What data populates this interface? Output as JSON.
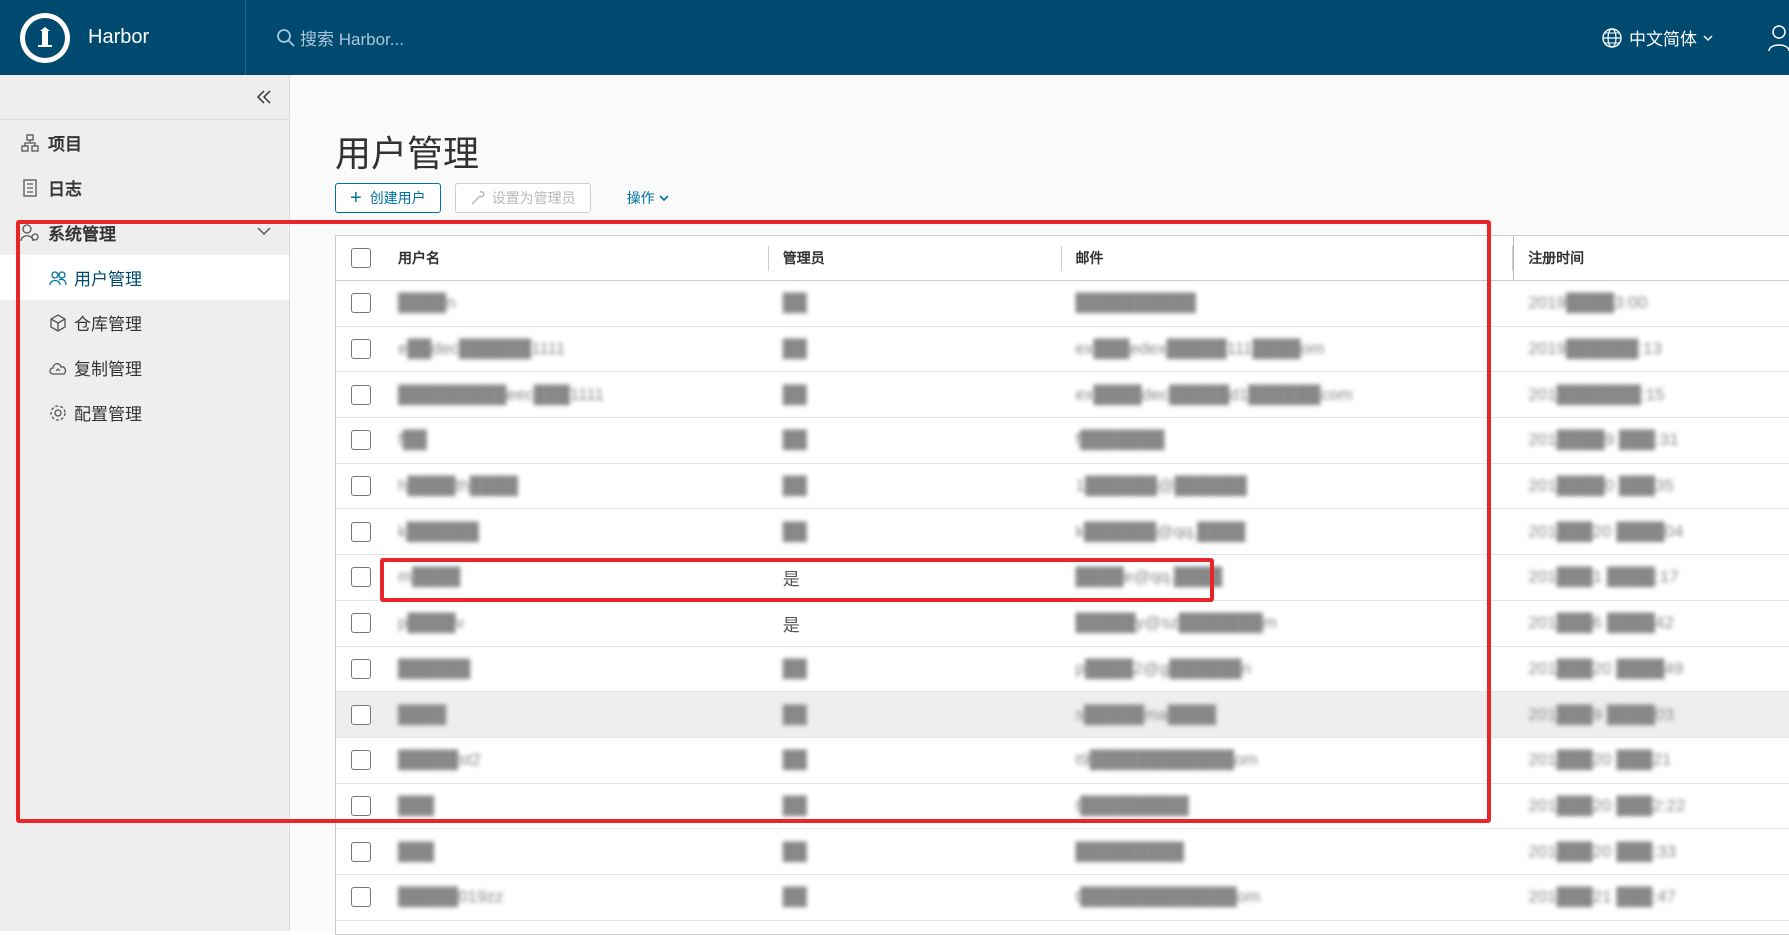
{
  "header": {
    "brand": "Harbor",
    "search_placeholder": "搜索 Harbor...",
    "language": "中文简体"
  },
  "sidebar": {
    "items": [
      {
        "label": "项目",
        "icon": "project-icon"
      },
      {
        "label": "日志",
        "icon": "log-icon"
      }
    ],
    "group": {
      "label": "系统管理",
      "icon": "admin-icon"
    },
    "sub_items": [
      {
        "label": "用户管理",
        "icon": "users-icon"
      },
      {
        "label": "仓库管理",
        "icon": "box-icon"
      },
      {
        "label": "复制管理",
        "icon": "cloud-icon"
      },
      {
        "label": "配置管理",
        "icon": "gear-icon"
      }
    ]
  },
  "main": {
    "title": "用户管理",
    "create_button": "创建用户",
    "set_admin_button": "设置为管理员",
    "actions_link": "操作"
  },
  "table": {
    "headers": [
      "用户名",
      "管理员",
      "邮件",
      "注册时间"
    ],
    "rows": [
      {
        "user": "████n",
        "admin": "██",
        "email": "██████████",
        "time": "2019████3:00"
      },
      {
        "user": "e██dec██████1111",
        "admin": "██",
        "email": "ex███edex█████111████om",
        "time": "2019██████:13"
      },
      {
        "user": "█████████eec███1111",
        "admin": "██",
        "email": "ex████dec█████d1██████com",
        "time": "201███████:15"
      },
      {
        "user": "f██",
        "admin": "██",
        "email": "f███████",
        "time": "201████9 ███:31"
      },
      {
        "user": "h████th████",
        "admin": "██",
        "email": "1██████@██████",
        "time": "201████0 ███35"
      },
      {
        "user": "k██████",
        "admin": "██",
        "email": "k██████@qq.████",
        "time": "201███20 ████04"
      },
      {
        "user": "m████",
        "admin": "是",
        "email": "████e@qq.████",
        "time": "201███1 ████:17"
      },
      {
        "user": "p████v",
        "admin": "是",
        "email": "█████y@sz███████m",
        "time": "201███6 ████42"
      },
      {
        "user": "██████",
        "admin": "██",
        "email": "p████2@g██████n",
        "time": "201███20 ████49"
      },
      {
        "user": "████",
        "admin": "██",
        "email": "s█████ma████",
        "time": "201███9 ████03"
      },
      {
        "user": "█████st2",
        "admin": "██",
        "email": "t9████████████om",
        "time": "201███20 ███21"
      },
      {
        "user": "███",
        "admin": "██",
        "email": "t█████████",
        "time": "201███20 ███2:22"
      },
      {
        "user": "███",
        "admin": "██",
        "email": "█████████",
        "time": "201███20 ███:33"
      },
      {
        "user": "█████019zz",
        "admin": "██",
        "email": "t█████████████om",
        "time": "201███21 ███:47"
      }
    ]
  },
  "colors": {
    "header_bg": "#004a70",
    "highlight": "#e8262a",
    "accent": "#0072a3"
  }
}
